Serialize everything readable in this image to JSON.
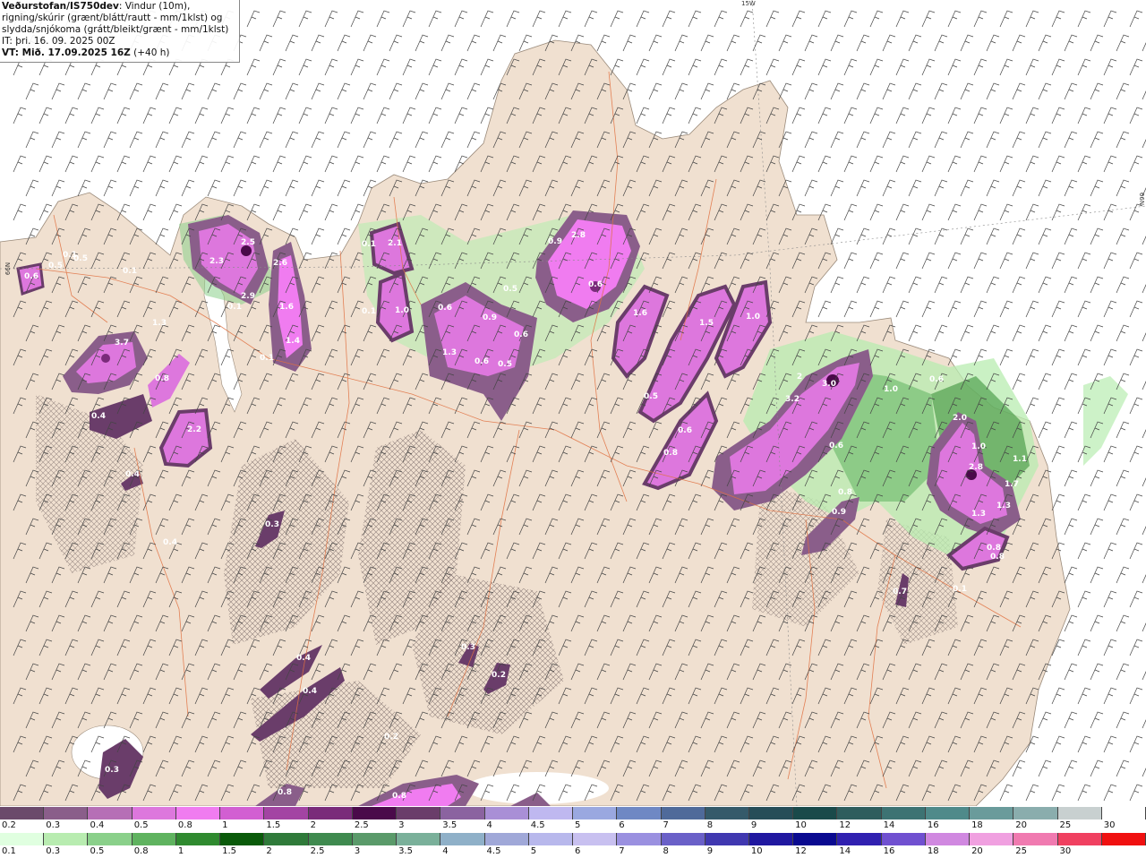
{
  "title": {
    "line1_bold": "Veðurstofan/IS750dev",
    "line1_rest": ": Vindur (10m),",
    "line2": "rigning/skúrir (grænt/blátt/rautt - mm/1klst) og",
    "line3": "slydda/snjókoma (grátt/bleikt/grænt - mm/1klst)",
    "line4": "IT: þri. 16. 09. 2025 00Z",
    "line5_bold": "VT: Mið. 17.09.2025 16Z",
    "line5_rest": " (+40 h)"
  },
  "grid_labels": {
    "lon": "15W",
    "lat_right": "66N",
    "lat_left": "66N"
  },
  "precip_labels": [
    "0.6",
    "0.5",
    "0.5",
    "0.1",
    "0.1",
    "2.3",
    "2.5",
    "2.6",
    "2.9",
    "0.1",
    "1.6",
    "1.4",
    "0.1",
    "3.7",
    "1.3",
    "0.8",
    "0.4",
    "2.2",
    "0.4",
    "2.1",
    "0.1",
    "1.0",
    "0.1",
    "0.6",
    "0.9",
    "0.9",
    "2.8",
    "0.6",
    "0.5",
    "0.6",
    "1.3",
    "0.6",
    "0.5",
    "1.6",
    "1.5",
    "1.0",
    "0.5",
    "0.6",
    "0.8",
    "2",
    "3.0",
    "3.2",
    "0.6",
    "0.8",
    "1.0",
    "0.6",
    "2.0",
    "1.0",
    "2.8",
    "1.1",
    "1.7",
    "1.3",
    "1.3",
    "0.8",
    "0.8",
    "0.9",
    "0.7",
    "0.3",
    "0.4",
    "0.4",
    "0.3",
    "0.2",
    "0.4",
    "0.2",
    "0.3",
    "0.8",
    "0.8",
    "0.1"
  ],
  "legend_snow": {
    "colors": [
      "#6b4a6b",
      "#8a5e8a",
      "#b66fb6",
      "#dd77dd",
      "#f07cf0",
      "#d25fd2",
      "#a344a3",
      "#7a2b7a",
      "#4a0a4a",
      "#6a3d6a",
      "#8b63a0",
      "#a98fd6",
      "#bfb8f0",
      "#9aa8e0",
      "#6f88c4",
      "#4f6a9a",
      "#355a6a",
      "#264d58",
      "#1a4a4a",
      "#2e5d5d",
      "#3d7373",
      "#4f8a8a",
      "#6a9b9b",
      "#8aadad",
      "#c8d0d0",
      "#ffffff"
    ],
    "labels": [
      "0.2",
      "0.3",
      "0.4",
      "0.5",
      "0.8",
      "1",
      "1.5",
      "2",
      "2.5",
      "3",
      "3.5",
      "4",
      "4.5",
      "5",
      "6",
      "7",
      "8",
      "9",
      "10",
      "12",
      "14",
      "16",
      "18",
      "20",
      "25",
      "30"
    ]
  },
  "legend_rain": {
    "colors": [
      "#e0ffe0",
      "#b8ecb0",
      "#8ad08a",
      "#5fb35f",
      "#2f8a2f",
      "#0a5a0a",
      "#2f7a3a",
      "#3f8a4f",
      "#5a9a6a",
      "#7ab09a",
      "#8fb0c8",
      "#a0a8d8",
      "#b8b8ec",
      "#c8c0f0",
      "#9a90e0",
      "#6a60c8",
      "#4038b0",
      "#2018a0",
      "#0a0a90",
      "#3020b0",
      "#7050d0",
      "#d088e0",
      "#f0a0e0",
      "#f07ab0",
      "#f04060",
      "#f01010"
    ],
    "labels": [
      "0.1",
      "0.3",
      "0.5",
      "0.8",
      "1",
      "1.5",
      "2",
      "2.5",
      "3",
      "3.5",
      "4",
      "4.5",
      "5",
      "6",
      "7",
      "8",
      "9",
      "10",
      "12",
      "14",
      "16",
      "18",
      "20",
      "25",
      "30"
    ]
  },
  "colors": {
    "land": "#f0e0d0",
    "sea": "#ffffff",
    "roads": "#e0703a",
    "snow_dark": "#6a3d6a",
    "snow_mid": "#d25fd2",
    "snow_light": "#f07cf0",
    "rain_green": "#8ad08a"
  }
}
